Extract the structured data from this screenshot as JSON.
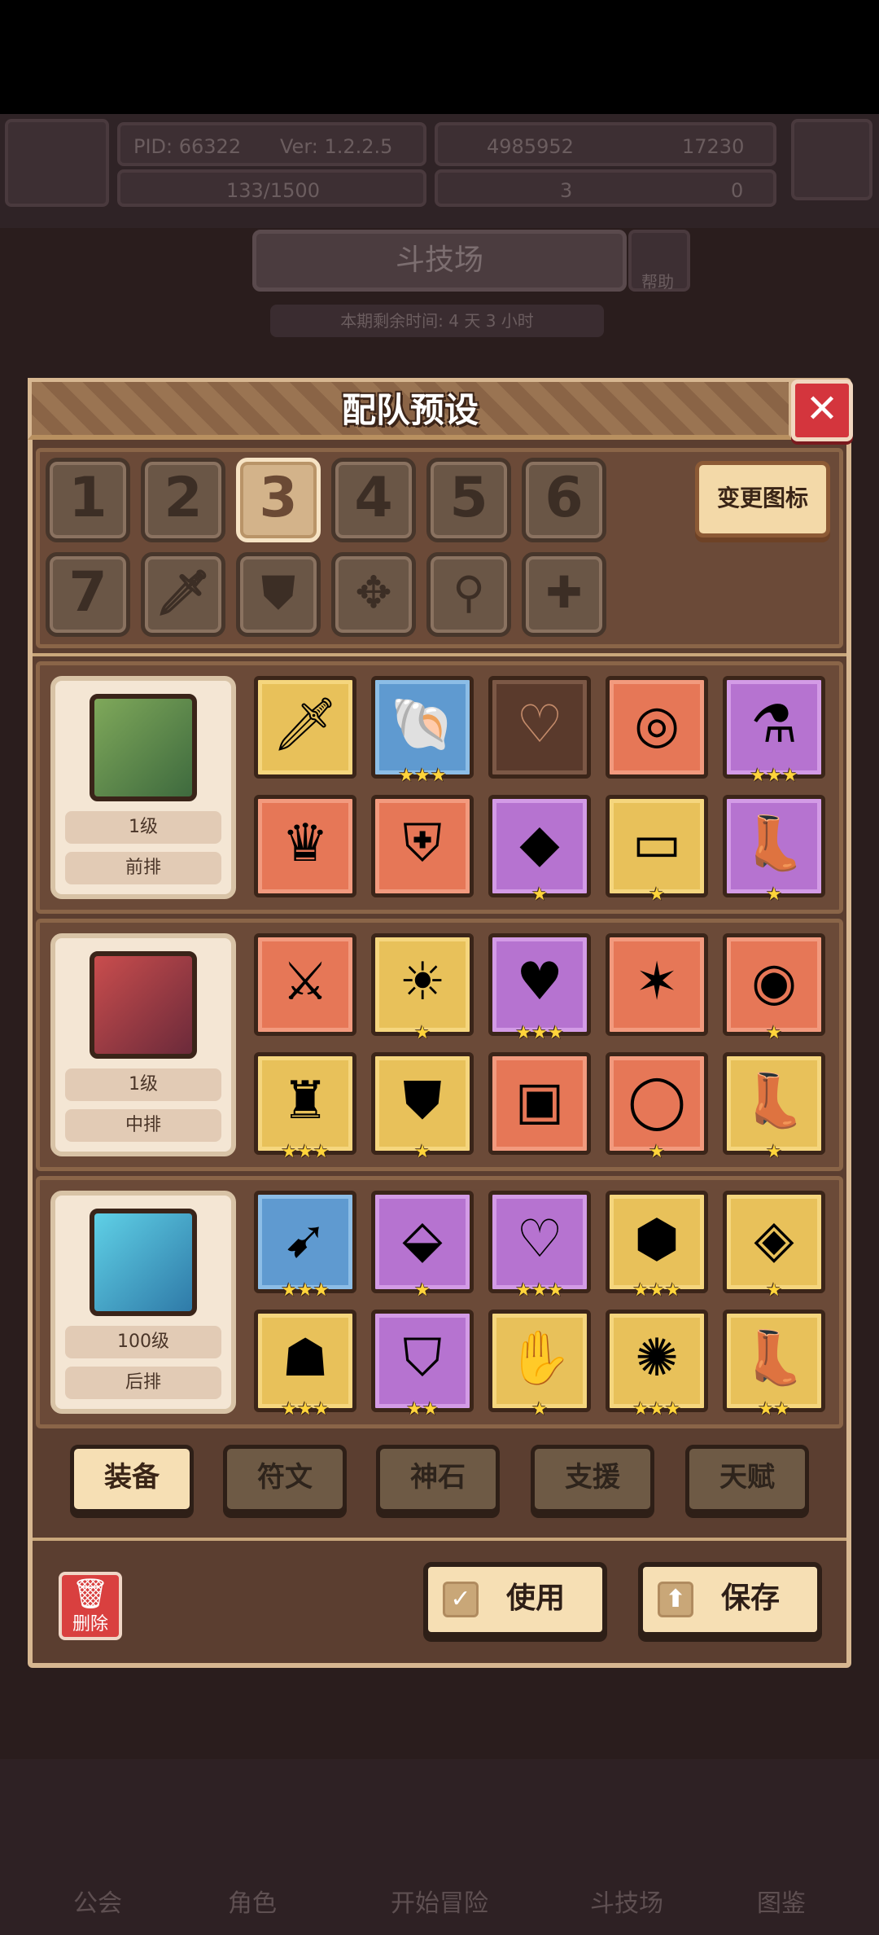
{
  "top_bar": {
    "pid": "PID: 66322",
    "version": "Ver: 1.2.2.5",
    "gold": "4985952",
    "gems": "17230",
    "stamina": "133/1500",
    "count_a": "3",
    "count_b": "0"
  },
  "background": {
    "title": "斗技场",
    "help": "帮助",
    "remaining": "本期剩余时间: 4 天 3 小时",
    "nav": [
      "公会",
      "角色",
      "开始冒险",
      "斗技场",
      "图鉴"
    ]
  },
  "modal": {
    "title": "配队预设",
    "close_icon": "close-icon",
    "change_icon_label": "变更图标",
    "preset_slots": [
      "1",
      "2",
      "3",
      "4",
      "5",
      "6",
      "7"
    ],
    "selected_slot": 3,
    "icon_slots": [
      "sword-icon",
      "shield-icon",
      "crosshair-icon",
      "staff-icon",
      "plus-icon"
    ],
    "heroes": [
      {
        "level": "1级",
        "position": "前排",
        "portrait": "hero-portrait-1",
        "items": [
          {
            "icon": "sword-icon",
            "rarity": "gold",
            "stars": ""
          },
          {
            "icon": "shell-icon",
            "rarity": "blue",
            "stars": "★★★"
          },
          {
            "icon": "heart-slot-icon",
            "rarity": "empty",
            "stars": ""
          },
          {
            "icon": "ring-icon",
            "rarity": "orange",
            "stars": ""
          },
          {
            "icon": "potion-icon",
            "rarity": "purple",
            "stars": "★★★"
          },
          {
            "icon": "horned-helmet-icon",
            "rarity": "orange",
            "stars": ""
          },
          {
            "icon": "armor-icon",
            "rarity": "orange",
            "stars": ""
          },
          {
            "icon": "crystal-icon",
            "rarity": "purple",
            "stars": "★"
          },
          {
            "icon": "belt-icon",
            "rarity": "gold",
            "stars": "★"
          },
          {
            "icon": "boots-icon",
            "rarity": "purple",
            "stars": "★"
          }
        ]
      },
      {
        "level": "1级",
        "position": "中排",
        "portrait": "hero-portrait-2",
        "items": [
          {
            "icon": "crossed-blades-icon",
            "rarity": "orange",
            "stars": ""
          },
          {
            "icon": "lantern-icon",
            "rarity": "gold",
            "stars": "★"
          },
          {
            "icon": "necklace-icon",
            "rarity": "purple",
            "stars": "★★★"
          },
          {
            "icon": "star-gem-icon",
            "rarity": "orange",
            "stars": ""
          },
          {
            "icon": "fire-ring-icon",
            "rarity": "orange",
            "stars": "★"
          },
          {
            "icon": "winged-helmet-icon",
            "rarity": "gold",
            "stars": "★★★"
          },
          {
            "icon": "dark-armor-icon",
            "rarity": "gold",
            "stars": "★"
          },
          {
            "icon": "lava-armor-icon",
            "rarity": "orange",
            "stars": ""
          },
          {
            "icon": "bracelet-icon",
            "rarity": "orange",
            "stars": "★"
          },
          {
            "icon": "golden-boots-icon",
            "rarity": "gold",
            "stars": "★"
          }
        ]
      },
      {
        "level": "100级",
        "position": "后排",
        "portrait": "hero-portrait-3",
        "items": [
          {
            "icon": "spear-icon",
            "rarity": "blue",
            "stars": "★★★"
          },
          {
            "icon": "crystal-orb-icon",
            "rarity": "purple",
            "stars": "★"
          },
          {
            "icon": "amulet-icon",
            "rarity": "purple",
            "stars": "★★★"
          },
          {
            "icon": "gem-icon",
            "rarity": "gold",
            "stars": "★★★"
          },
          {
            "icon": "ice-ring-icon",
            "rarity": "gold",
            "stars": "★"
          },
          {
            "icon": "hood-icon",
            "rarity": "gold",
            "stars": "★★★"
          },
          {
            "icon": "cloak-icon",
            "rarity": "purple",
            "stars": "★★"
          },
          {
            "icon": "ice-gloves-icon",
            "rarity": "gold",
            "stars": "★"
          },
          {
            "icon": "spiked-armor-icon",
            "rarity": "gold",
            "stars": "★★★"
          },
          {
            "icon": "iron-boots-icon",
            "rarity": "gold",
            "stars": "★★"
          }
        ]
      }
    ],
    "tabs": [
      "装备",
      "符文",
      "神石",
      "支援",
      "天赋"
    ],
    "active_tab": "装备",
    "delete_label": "删除",
    "use_label": "使用",
    "save_label": "保存"
  },
  "colors": {
    "frame": "#d7b791",
    "panel": "#5b3e30",
    "close": "#d4353d",
    "button": "#f6dfb4"
  }
}
